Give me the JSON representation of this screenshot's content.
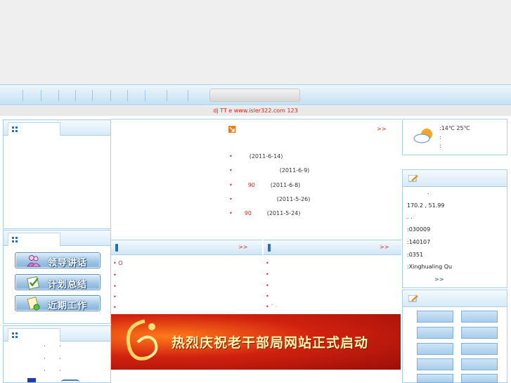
{
  "marquee": {
    "text": "dj    TT    e      www.isler322.com 123"
  },
  "news": {
    "more": ">>",
    "items": [
      {
        "title": "",
        "date": "(2011-6-14)"
      },
      {
        "title": "",
        "date": "(2011-6-9)"
      },
      {
        "title": "90",
        "date": "(2011-6-8)"
      },
      {
        "title": "",
        "date": "(2011-5-26)"
      },
      {
        "title": "90",
        "date": "(2011-5-24)"
      }
    ]
  },
  "subpanels": {
    "left_more": ">>",
    "right_more": ">>",
    "left_first": "O"
  },
  "quick_links": [
    {
      "label": "领导讲话",
      "icon": "people-icon"
    },
    {
      "label": "计划总结",
      "icon": "checklist-icon"
    },
    {
      "label": "近期工作",
      "icon": "document-icon"
    }
  ],
  "banner": {
    "title": "热烈庆祝老干部局网站正式启动"
  },
  "weather": {
    "temp": ":14℃ 25℃",
    "line2": ":",
    "line3": ":"
  },
  "info": {
    "line0": ".",
    "line1": "170.2   ,    51.99",
    "line2": ".       .",
    "line3": ":030009",
    "line4": ":140107",
    "line5": ":0351",
    "line6": ":Xinghualing Qu",
    "more": ">>"
  },
  "colors": {
    "accent": "#2a6fb2",
    "border": "#a9cfe8",
    "red": "#d62a1e"
  }
}
